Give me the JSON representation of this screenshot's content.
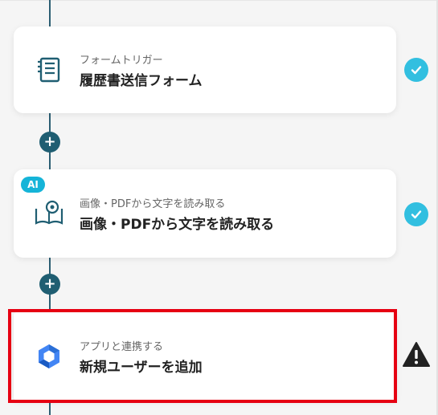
{
  "colors": {
    "accent": "#1f5e72",
    "check": "#32bfe0",
    "ai": "#15b4d8",
    "highlight": "#e60012",
    "warning": "#222222"
  },
  "steps": [
    {
      "subtitle": "フォームトリガー",
      "title": "履歴書送信フォーム",
      "icon": "form-icon",
      "status": "completed-check-icon"
    },
    {
      "badge": "AI",
      "subtitle": "画像・PDFから文字を読み取る",
      "title": "画像・PDFから文字を読み取る",
      "icon": "read-document-icon",
      "status": "completed-check-icon"
    },
    {
      "subtitle": "アプリと連携する",
      "title": "新規ユーザーを追加",
      "icon": "google-workspace-icon",
      "status": "warning-icon"
    }
  ],
  "add_buttons": [
    "+",
    "+"
  ]
}
